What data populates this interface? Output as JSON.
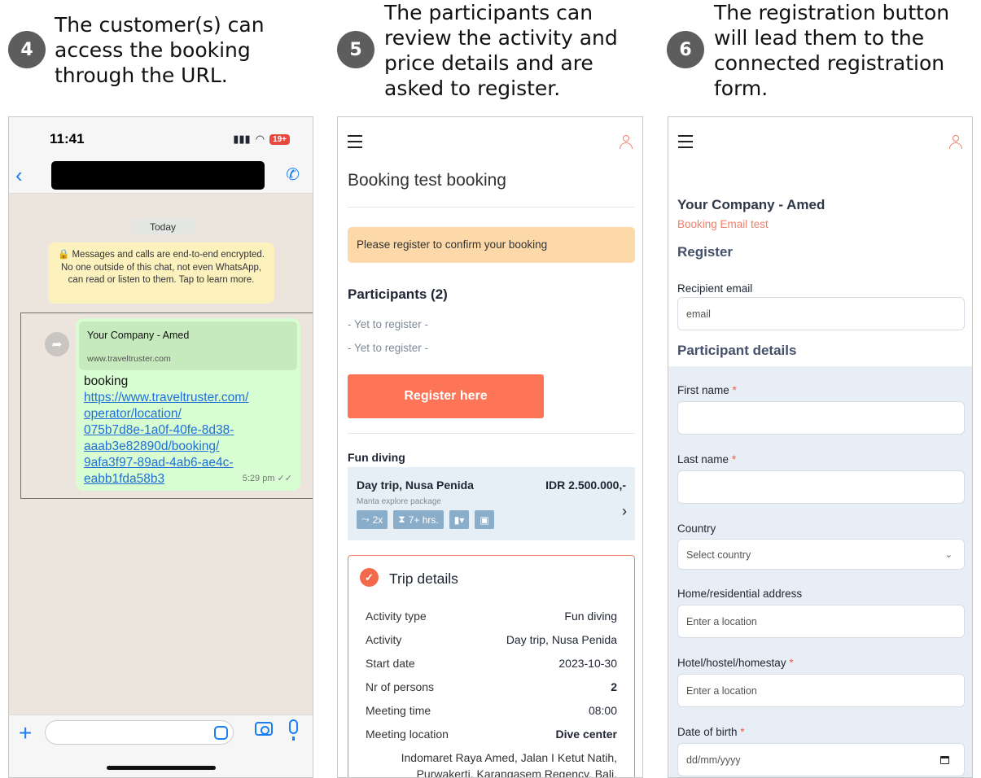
{
  "steps": [
    {
      "num": "4",
      "text": "The customer(s) can\naccess the booking\nthrough the URL."
    },
    {
      "num": "5",
      "text": "The participants can\nreview the activity and\nprice details and are\nasked to register."
    },
    {
      "num": "6",
      "text": "The registration button\nwill lead them to the\nconnected registration\nform."
    }
  ],
  "whatsapp": {
    "time": "11:41",
    "battery": "19+",
    "date_chip": "Today",
    "encryption_notice": "🔒 Messages and calls are end-to-end encrypted. No one outside of this chat, not even WhatsApp, can read or listen to them. Tap to learn more.",
    "preview_title": "Your Company - Amed",
    "preview_url": "www.traveltruster.com",
    "message_text": "booking",
    "message_link": "https://www.traveltruster.com/\noperator/location/\n075b7d8e-1a0f-40fe-8d38-\naaab3e82890d/booking/\n9afa3f97-89ad-4ab6-ae4c-\neabb1fda58b3",
    "message_time": "5:29 pm ✓✓"
  },
  "booking": {
    "title": "Booking test booking",
    "alert": "Please register to confirm your booking",
    "participants_heading": "Participants (2)",
    "participants": [
      "- Yet to register -",
      "- Yet to register -"
    ],
    "register_button": "Register here",
    "section_label": "Fun diving",
    "trip_title": "Day trip, Nusa Penida",
    "trip_price": "IDR 2.500.000,-",
    "trip_sub": "Manta explore package",
    "badges": {
      "dives": "2x",
      "hours": "7+ hrs."
    },
    "details_title": "Trip details",
    "details": [
      {
        "k": "Activity type",
        "v": "Fun diving"
      },
      {
        "k": "Activity",
        "v": "Day trip, Nusa Penida"
      },
      {
        "k": "Start date",
        "v": "2023-10-30"
      },
      {
        "k": "Nr of persons",
        "v": "2"
      },
      {
        "k": "Meeting time",
        "v": "08:00"
      },
      {
        "k": "Meeting location",
        "v": "Dive center"
      }
    ],
    "address": "Indomaret Raya Amed, Jalan I Ketut Natih,\nPurwakerti, Karangasem Regency, Bali,"
  },
  "registration": {
    "company": "Your Company - Amed",
    "booking_name": "Booking Email test",
    "register_heading": "Register",
    "recipient_label": "Recipient email",
    "email_placeholder": "email",
    "participant_heading": "Participant details",
    "first_name": "First name",
    "last_name": "Last name",
    "country": "Country",
    "country_placeholder": "Select country",
    "home_address": "Home/residential address",
    "location_placeholder": "Enter a location",
    "hotel": "Hotel/hostel/homestay",
    "dob": "Date of birth",
    "dob_placeholder": "dd/mm/yyyy",
    "required_mark": "*"
  },
  "colors": {
    "accent": "#fe7456",
    "wa_blue": "#1b7ef2",
    "wa_bubble": "#d9fdd3",
    "alert": "#fdd8a8"
  }
}
